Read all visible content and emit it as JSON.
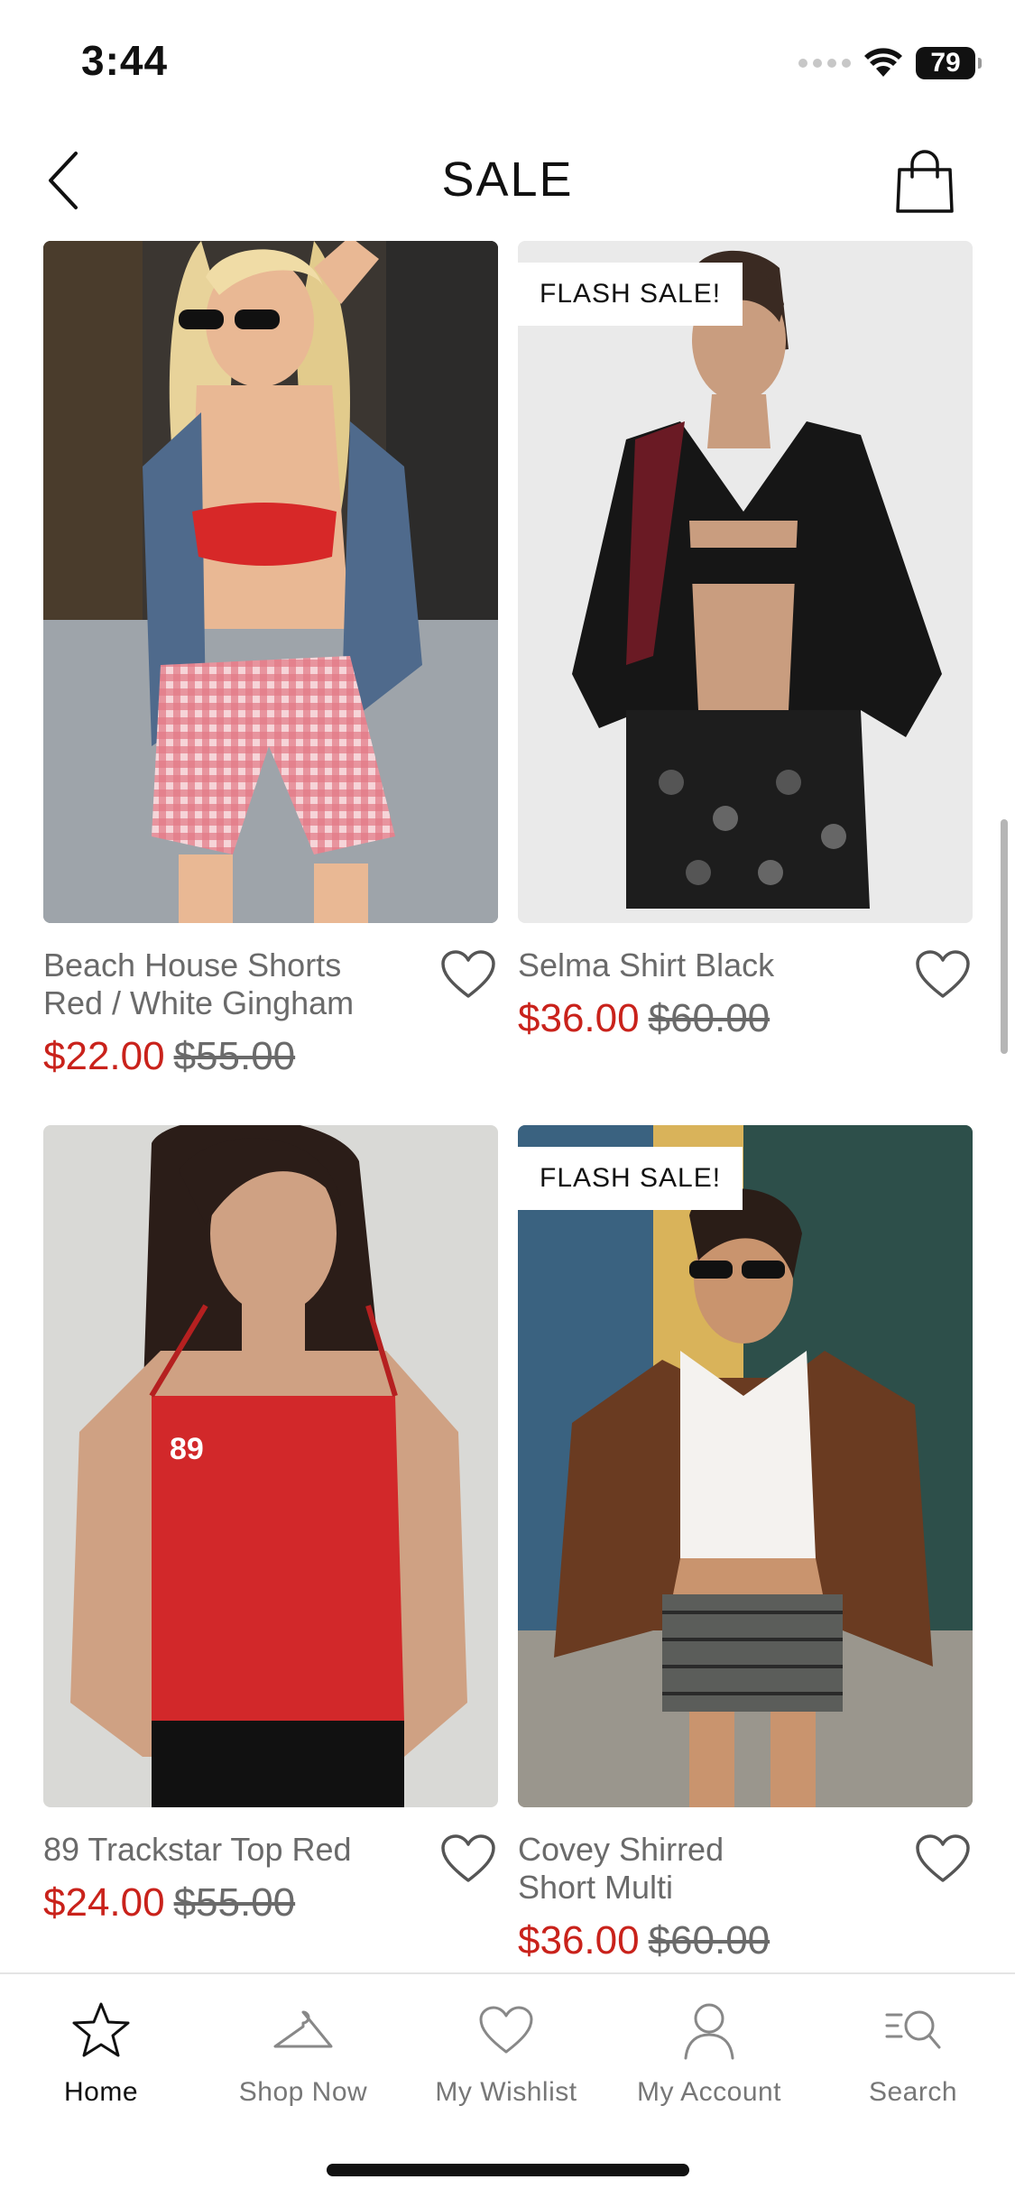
{
  "status_bar": {
    "time": "3:44",
    "battery": "79"
  },
  "header": {
    "title": "SALE"
  },
  "products": [
    {
      "name_line1": "Beach House Shorts",
      "name_line2": "Red / White Gingham",
      "sale_price": "$22.00",
      "original_price": "$55.00",
      "badge": ""
    },
    {
      "name_line1": "Selma Shirt Black",
      "name_line2": "",
      "sale_price": "$36.00",
      "original_price": "$60.00",
      "badge": "FLASH SALE!"
    },
    {
      "name_line1": "89 Trackstar Top Red",
      "name_line2": "",
      "sale_price": "$24.00",
      "original_price": "$55.00",
      "badge": ""
    },
    {
      "name_line1": "Covey Shirred",
      "name_line2": "Short Multi",
      "sale_price": "$36.00",
      "original_price": "$60.00",
      "badge": "FLASH SALE!"
    }
  ],
  "tabs": [
    {
      "label": "Home",
      "icon": "star-icon",
      "active": true
    },
    {
      "label": "Shop Now",
      "icon": "hanger-icon",
      "active": false
    },
    {
      "label": "My Wishlist",
      "icon": "heart-icon",
      "active": false
    },
    {
      "label": "My Account",
      "icon": "person-icon",
      "active": false
    },
    {
      "label": "Search",
      "icon": "search-icon",
      "active": false
    }
  ],
  "colors": {
    "sale_price": "#c9221b",
    "muted_text": "#6a6a6a",
    "accent": "#111111"
  }
}
